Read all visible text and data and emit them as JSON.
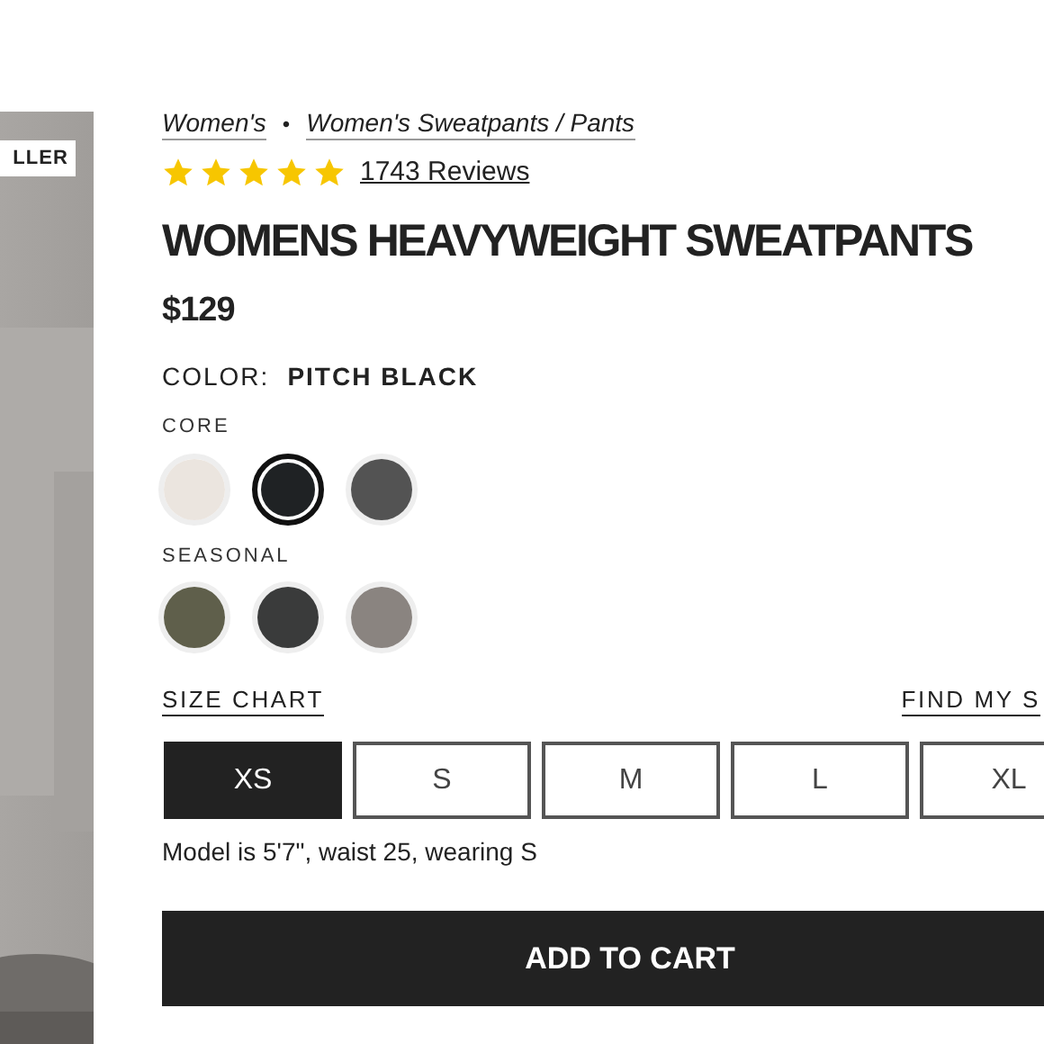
{
  "product_image": {
    "badge": "LLER"
  },
  "breadcrumbs": [
    {
      "label": "Women's"
    },
    {
      "label": "Women's Sweatpants / Pants"
    }
  ],
  "separator": "•",
  "rating": {
    "stars": 5,
    "reviews": "1743 Reviews"
  },
  "title": "WOMENS HEAVYWEIGHT SWEATPANTS",
  "price": "$129",
  "color": {
    "label": "COLOR:",
    "value": "PITCH BLACK"
  },
  "swatch_groups": [
    {
      "name": "CORE",
      "swatches": [
        {
          "color": "#ebe5df",
          "selected": false
        },
        {
          "color": "#1f2224",
          "selected": true
        },
        {
          "color": "#535353",
          "selected": false
        }
      ]
    },
    {
      "name": "SEASONAL",
      "swatches": [
        {
          "color": "#5f5f4b",
          "selected": false
        },
        {
          "color": "#3a3b3b",
          "selected": false
        },
        {
          "color": "#8a8480",
          "selected": false
        }
      ]
    }
  ],
  "size_chart_link": "SIZE CHART",
  "find_size_link": "FIND MY S",
  "sizes": [
    {
      "label": "XS",
      "selected": true
    },
    {
      "label": "S",
      "selected": false
    },
    {
      "label": "M",
      "selected": false
    },
    {
      "label": "L",
      "selected": false
    },
    {
      "label": "XL",
      "selected": false
    }
  ],
  "model_note": "Model is 5'7\", waist 25, wearing S",
  "add_to_cart": "ADD TO CART"
}
